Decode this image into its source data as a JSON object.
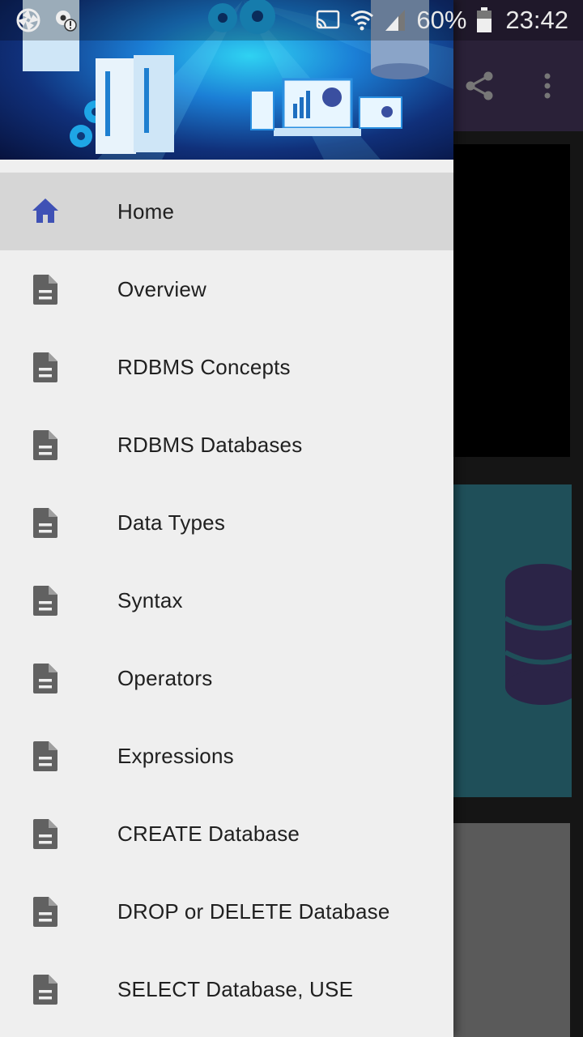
{
  "status_bar": {
    "battery": "60%",
    "time": "23:42",
    "icons": [
      "aperture-icon",
      "settings-alert-icon",
      "cast-icon",
      "wifi-icon",
      "signal-icon",
      "battery-icon"
    ]
  },
  "app_bar": {
    "actions": [
      "share-icon",
      "more-vert-icon"
    ]
  },
  "drawer": {
    "header_image": "database-servers-illustration",
    "items": [
      {
        "label": "Home",
        "icon": "home-icon",
        "active": true
      },
      {
        "label": "Overview",
        "icon": "document-icon"
      },
      {
        "label": "RDBMS Concepts",
        "icon": "document-icon"
      },
      {
        "label": "RDBMS Databases",
        "icon": "document-icon"
      },
      {
        "label": "Data Types",
        "icon": "document-icon"
      },
      {
        "label": "Syntax",
        "icon": "document-icon"
      },
      {
        "label": "Operators",
        "icon": "document-icon"
      },
      {
        "label": "Expressions",
        "icon": "document-icon"
      },
      {
        "label": "CREATE Database",
        "icon": "document-icon"
      },
      {
        "label": "DROP or DELETE Database",
        "icon": "document-icon"
      },
      {
        "label": "SELECT Database, USE",
        "icon": "document-icon"
      }
    ]
  },
  "colors": {
    "accent": "#3f51b5",
    "drawer_bg": "#efefef",
    "active_item_bg": "#d6d6d6",
    "icon_gray": "#616161",
    "app_bar": "#2a2138"
  }
}
